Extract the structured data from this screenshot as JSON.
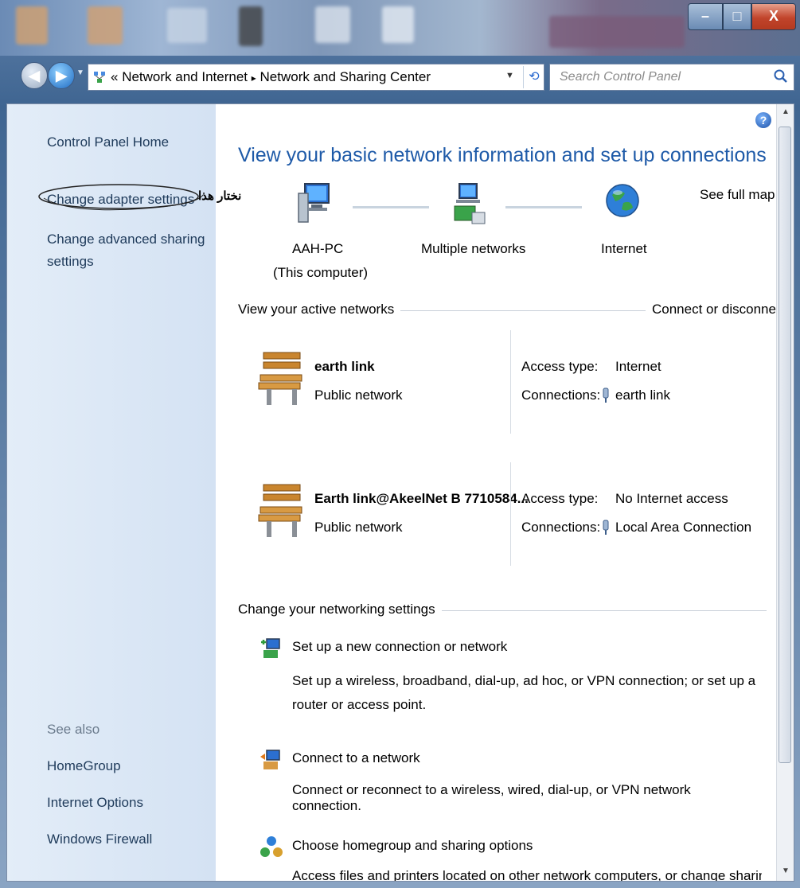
{
  "window": {
    "controls": {
      "minimize": "–",
      "maximize": "□",
      "close": "X"
    }
  },
  "nav": {
    "back_icon": "back-arrow-icon",
    "forward_icon": "forward-arrow-icon",
    "breadcrumb": {
      "prefix": "«",
      "item1": "Network and Internet",
      "separator": "▸",
      "item2": "Network and Sharing Center"
    },
    "search_placeholder": "Search Control Panel"
  },
  "sidebar": {
    "home": "Control Panel Home",
    "items": [
      {
        "label": "Change adapter settings"
      },
      {
        "label": "Change advanced sharing settings"
      }
    ],
    "annotation": "نختار هذا",
    "see_also_title": "See also",
    "see_also": [
      {
        "label": "HomeGroup"
      },
      {
        "label": "Internet Options"
      },
      {
        "label": "Windows Firewall"
      }
    ]
  },
  "main": {
    "heading": "View your basic network information and set up connections",
    "see_full_map": "See full map",
    "map": {
      "computer_name": "AAH-PC",
      "computer_sub": "(This computer)",
      "middle": "Multiple networks",
      "internet": "Internet"
    },
    "active_section": "View your active networks",
    "connect_disconnect": "Connect or disconnect",
    "networks": [
      {
        "name": "earth link",
        "type": "Public network",
        "access_label": "Access type:",
        "access_value": "Internet",
        "connections_label": "Connections:",
        "connections_value": "earth link"
      },
      {
        "name": "Earth link@AkeelNet B 7710584...",
        "type": "Public network",
        "access_label": "Access type:",
        "access_value": "No Internet access",
        "connections_label": "Connections:",
        "connections_value": "Local Area Connection"
      }
    ],
    "change_section": "Change your networking settings",
    "tasks": [
      {
        "title": "Set up a new connection or network",
        "desc": "Set up a wireless, broadband, dial-up, ad hoc, or VPN connection; or set up a router or access point."
      },
      {
        "title": "Connect to a network",
        "desc": "Connect or reconnect to a wireless, wired, dial-up, or VPN network connection."
      },
      {
        "title": "Choose homegroup and sharing options",
        "desc": "Access files and printers located on other network computers, or change sharing settings."
      }
    ]
  },
  "colors": {
    "link": "#1f5bbf",
    "heading": "#1e5aa8",
    "sidebar_bg": "#dbe7f5"
  }
}
